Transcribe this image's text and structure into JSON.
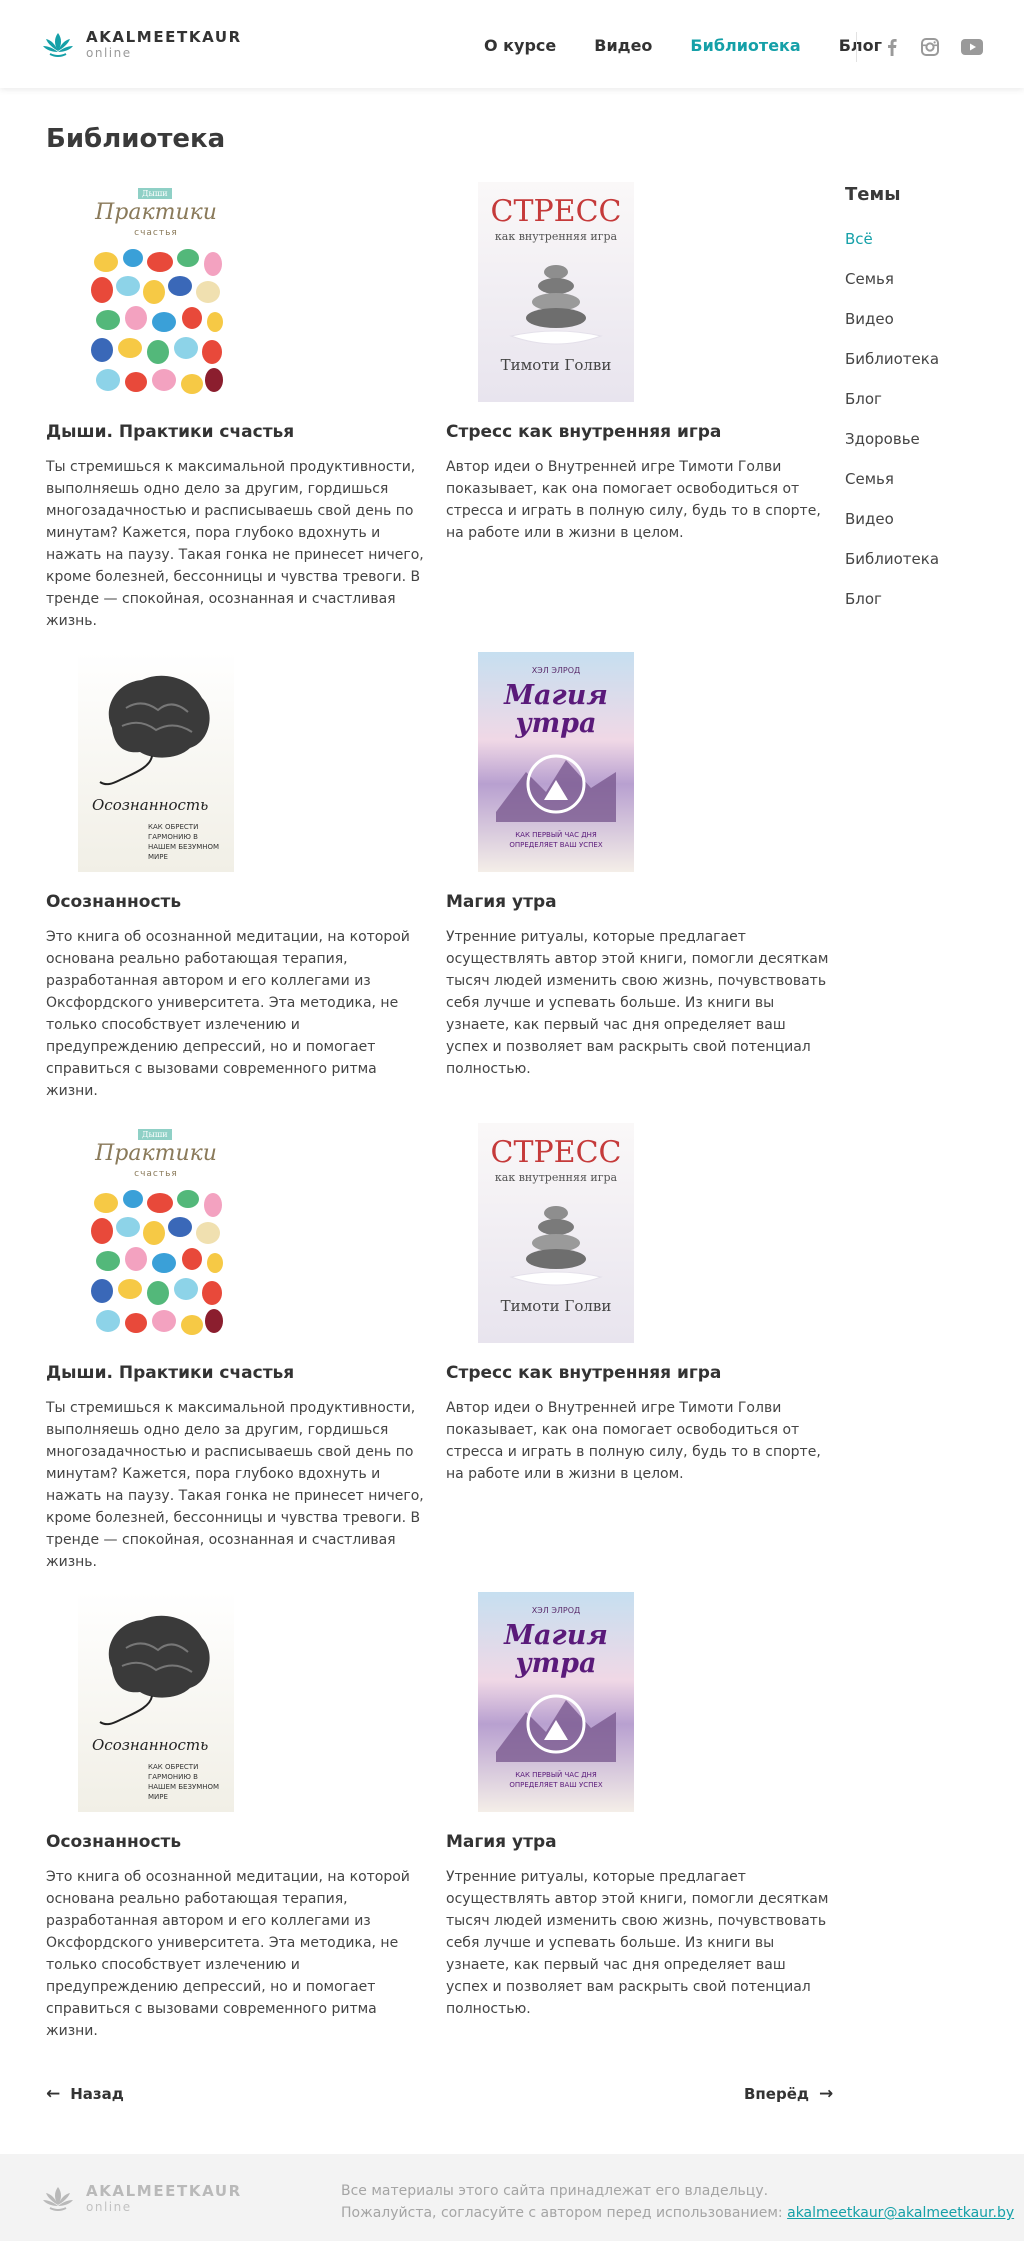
{
  "header": {
    "logo_name": "AKALMEETKAUR",
    "logo_sub": "online",
    "nav": [
      {
        "label": "О курсе"
      },
      {
        "label": "Видео"
      },
      {
        "label": "Библиотека",
        "active": true
      },
      {
        "label": "Блог"
      }
    ],
    "social_icons": [
      "facebook-icon",
      "instagram-icon",
      "youtube-icon"
    ]
  },
  "page_title": "Библиотека",
  "books": [
    {
      "title": "Дыши. Практики счастья",
      "description": "Ты стремишься к максимальной продуктивности, выполняешь одно дело за другим, гордишься многозадачностью и расписываешь свой день по минутам?  Кажется, пора глубоко вдохнуть и нажать на паузу. Такая гонка не принесет ничего, кроме болезней, бессонницы и чувства тревоги.  В тренде — спокойная, осознанная и счастливая жизнь.",
      "cover": {
        "top": "Дыши",
        "title": "Практики",
        "sub": "счастья"
      }
    },
    {
      "title": "Стресс как внутренняя игра",
      "description": "Автор идеи о  Внутренней игре Тимоти  Голви показывает, как она помогает освободиться от стресса и играть в полную силу, будь то в спорте, на работе или в жизни в целом.",
      "cover": {
        "title": "СТРЕСС",
        "sub": "как внутренняя игра",
        "author": "Тимоти Голви"
      }
    },
    {
      "title": "Осознанность",
      "description": "Это книга об осознанной медитации, на которой основана реально работающая терапия, разработанная автором и его коллегами из Оксфордского университета. Эта методика, не только способствует излечению и предупреждению депрессий, но и помогает справиться с вызовами современного ритма жизни.",
      "cover": {
        "title": "Осознанность",
        "sub": "Как обрести гармонию в нашем безумном мире"
      }
    },
    {
      "title": "Магия утра",
      "description": "Утренние ритуалы, которые предлагает осуществлять автор этой книги, помогли десяткам тысяч людей изменить свою жизнь, почувствовать себя лучше и успевать больше.  Из книги вы узнаете, как первый час дня определяет ваш успех и позволяет вам раскрыть свой потенциал полностью.",
      "cover": {
        "top": "Хэл Элрод",
        "title": "Магия утра",
        "sub": "Как первый час дня определяет ваш успех"
      }
    },
    {
      "title": "Дыши. Практики счастья",
      "description": "Ты стремишься к максимальной продуктивности, выполняешь одно дело за другим, гордишься многозадачностью и расписываешь свой день по минутам?  Кажется, пора глубоко вдохнуть и нажать на паузу. Такая гонка не принесет ничего, кроме болезней, бессонницы и чувства тревоги.  В тренде — спокойная, осознанная и счастливая жизнь.",
      "cover": {
        "top": "Дыши",
        "title": "Практики",
        "sub": "счастья"
      }
    },
    {
      "title": "Стресс как внутренняя игра",
      "description": "Автор идеи о  Внутренней игре Тимоти  Голви показывает, как она помогает освободиться от стресса и играть в полную силу, будь то в спорте, на работе или в жизни в целом.",
      "cover": {
        "title": "СТРЕСС",
        "sub": "как внутренняя игра",
        "author": "Тимоти Голви"
      }
    },
    {
      "title": "Осознанность",
      "description": "Это книга об осознанной медитации, на которой основана реально работающая терапия, разработанная автором и его коллегами из Оксфордского университета. Эта методика, не только способствует излечению и предупреждению депрессий, но и помогает справиться с вызовами современного ритма жизни.",
      "cover": {
        "title": "Осознанность",
        "sub": "Как обрести гармонию в нашем безумном мире"
      }
    },
    {
      "title": "Магия утра",
      "description": "Утренние ритуалы, которые предлагает осуществлять автор этой книги, помогли десяткам тысяч людей изменить свою жизнь, почувствовать себя лучше и успевать больше.  Из книги вы узнаете, как первый час дня определяет ваш успех и позволяет вам раскрыть свой потенциал полностью.",
      "cover": {
        "top": "Хэл Элрод",
        "title": "Магия утра",
        "sub": "Как первый час дня определяет ваш успех"
      }
    }
  ],
  "sidebar": {
    "title": "Темы",
    "items": [
      {
        "label": "Всё",
        "active": true
      },
      {
        "label": "Семья"
      },
      {
        "label": "Видео"
      },
      {
        "label": "Библиотека"
      },
      {
        "label": "Блог"
      },
      {
        "label": "Здоровье"
      },
      {
        "label": "Семья"
      },
      {
        "label": "Видео"
      },
      {
        "label": "Библиотека"
      },
      {
        "label": "Блог"
      }
    ]
  },
  "pagination": {
    "prev": "Назад",
    "next": "Вперёд",
    "prev_arrow": "←",
    "next_arrow": "→"
  },
  "footer": {
    "logo_name": "AKALMEETKAUR",
    "logo_sub": "online",
    "line1": "Все материалы этого сайта принадлежат его владельцу.",
    "line2": "Пожалуйста, согласуйте с автором перед использованием: ",
    "email": "akalmeetkaur@akalmeetkaur.by"
  },
  "colors": {
    "accent": "#15a0a8",
    "text": "#333333",
    "footer_bg": "#f3f3f3"
  }
}
